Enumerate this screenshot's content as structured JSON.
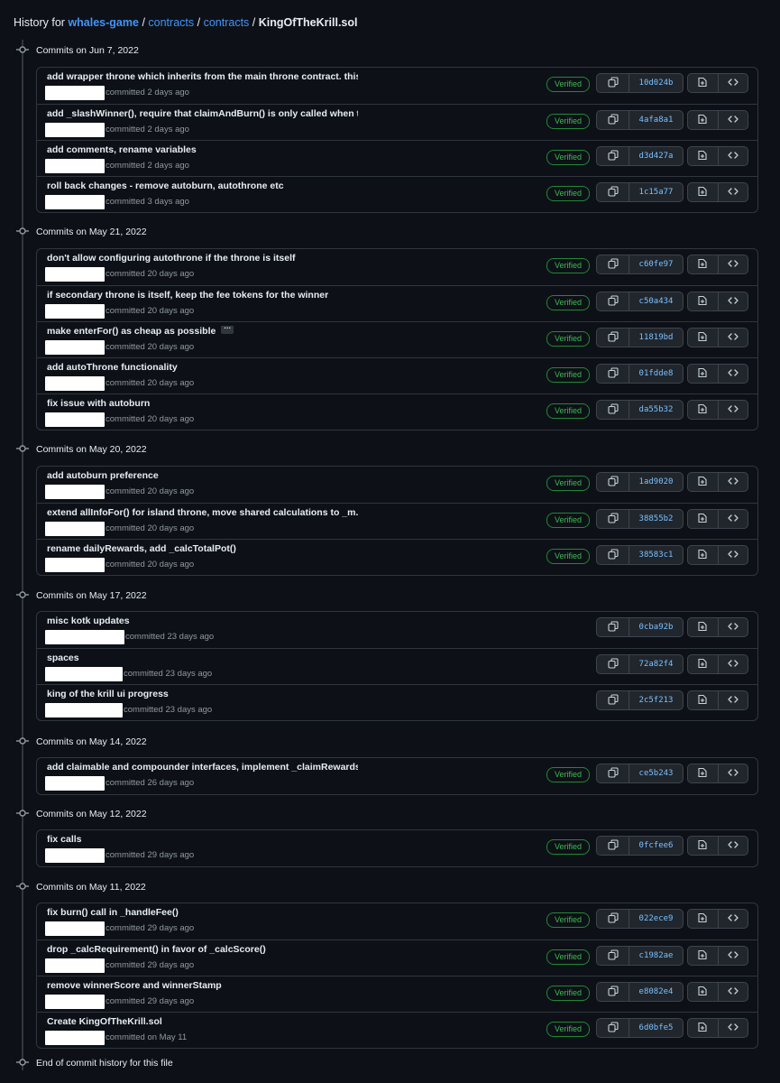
{
  "header": {
    "prefix": "History for",
    "repo": "whales-game",
    "path1": "contracts",
    "path2": "contracts",
    "file": "KingOfTheKrill.sol",
    "separator": "/"
  },
  "labels": {
    "verified": "Verified",
    "ellipsis": "···",
    "end_text": "End of commit history for this file"
  },
  "icons": {
    "commit": "git-commit-icon",
    "copy": "copy-icon",
    "browse": "file-diff-icon",
    "code": "code-icon"
  },
  "colors": {
    "background": "#0d1117",
    "link": "#4493f8",
    "verified": "#3fb950",
    "sha": "#79c0ff",
    "border": "#30363d"
  },
  "groups": [
    {
      "date": "Commits on Jun 7, 2022",
      "commits": [
        {
          "message": "add wrapper throne which inherits from the main throne contract. this...",
          "truncated": true,
          "meta": "committed 2 days ago",
          "verified": true,
          "sha": "10d024b"
        },
        {
          "message": "add _slashWinner(), require that claimAndBurn() is only called when t...",
          "truncated": true,
          "meta": "committed 2 days ago",
          "verified": true,
          "sha": "4afa8a1"
        },
        {
          "message": "add comments, rename variables",
          "truncated": false,
          "meta": "committed 2 days ago",
          "verified": true,
          "sha": "d3d427a"
        },
        {
          "message": "roll back changes - remove autoburn, autothrone etc",
          "truncated": false,
          "meta": "committed 3 days ago",
          "verified": true,
          "sha": "1c15a77"
        }
      ]
    },
    {
      "date": "Commits on May 21, 2022",
      "commits": [
        {
          "message": "don't allow configuring autothrone if the throne is itself",
          "truncated": false,
          "meta": "committed 20 days ago",
          "verified": true,
          "sha": "c60fe97"
        },
        {
          "message": "if secondary throne is itself, keep the fee tokens for the winner",
          "truncated": false,
          "meta": "committed 20 days ago",
          "verified": true,
          "sha": "c50a434"
        },
        {
          "message": "make enterFor() as cheap as possible",
          "truncated": true,
          "meta": "committed 20 days ago",
          "verified": true,
          "sha": "11819bd"
        },
        {
          "message": "add autoThrone functionality",
          "truncated": false,
          "meta": "committed 20 days ago",
          "verified": true,
          "sha": "01fdde8"
        },
        {
          "message": "fix issue with autoburn",
          "truncated": false,
          "meta": "committed 20 days ago",
          "verified": true,
          "sha": "da55b32"
        }
      ]
    },
    {
      "date": "Commits on May 20, 2022",
      "commits": [
        {
          "message": "add autoburn preference",
          "truncated": false,
          "meta": "committed 20 days ago",
          "verified": true,
          "sha": "1ad9020"
        },
        {
          "message": "extend allInfoFor() for island throne, move shared calculations to _m...",
          "truncated": true,
          "meta": "committed 20 days ago",
          "verified": true,
          "sha": "38855b2"
        },
        {
          "message": "rename dailyRewards, add _calcTotalPot()",
          "truncated": false,
          "meta": "committed 20 days ago",
          "verified": true,
          "sha": "38583c1"
        }
      ]
    },
    {
      "date": "Commits on May 17, 2022",
      "commits": [
        {
          "message": "misc kotk updates",
          "truncated": false,
          "meta": "committed 23 days ago",
          "verified": false,
          "sha": "0cba92b"
        },
        {
          "message": "spaces",
          "truncated": false,
          "meta": "committed 23 days ago",
          "verified": false,
          "sha": "72a82f4"
        },
        {
          "message": "king of the krill ui progress",
          "truncated": false,
          "meta": "committed 23 days ago",
          "verified": false,
          "sha": "2c5f213"
        }
      ]
    },
    {
      "date": "Commits on May 14, 2022",
      "commits": [
        {
          "message": "add claimable and compounder interfaces, implement _claimRewards()",
          "truncated": false,
          "meta": "committed 26 days ago",
          "verified": true,
          "sha": "ce5b243"
        }
      ]
    },
    {
      "date": "Commits on May 12, 2022",
      "commits": [
        {
          "message": "fix calls",
          "truncated": false,
          "meta": "committed 29 days ago",
          "verified": true,
          "sha": "0fcfee6"
        }
      ]
    },
    {
      "date": "Commits on May 11, 2022",
      "commits": [
        {
          "message": "fix burn() call in _handleFee()",
          "truncated": false,
          "meta": "committed 29 days ago",
          "verified": true,
          "sha": "022ece9"
        },
        {
          "message": "drop _calcRequirement() in favor of _calcScore()",
          "truncated": false,
          "meta": "committed 29 days ago",
          "verified": true,
          "sha": "c1982ae"
        },
        {
          "message": "remove winnerScore and winnerStamp",
          "truncated": false,
          "meta": "committed 29 days ago",
          "verified": true,
          "sha": "e8082e4"
        },
        {
          "message": "Create KingOfTheKrill.sol",
          "truncated": false,
          "meta": "committed on May 11",
          "verified": true,
          "sha": "6d0bfe5"
        }
      ]
    }
  ]
}
